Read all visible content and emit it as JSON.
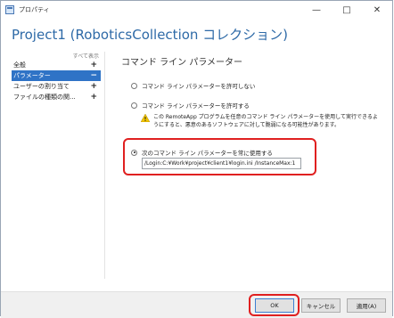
{
  "window": {
    "title": "プロパティ",
    "minimize": "—",
    "maximize": "□",
    "close": "✕"
  },
  "heading": "Project1 (RoboticsCollection コレクション)",
  "sidebar": {
    "show_all": "すべて表示",
    "items": [
      {
        "label": "全般",
        "sign": "+"
      },
      {
        "label": "パラメーター",
        "sign": "−"
      },
      {
        "label": "ユーザーの割り当て",
        "sign": "+"
      },
      {
        "label": "ファイルの種類の関...",
        "sign": "+"
      }
    ]
  },
  "main": {
    "section_title": "コマンド ライン パラメーター",
    "options": [
      {
        "label": "コマンド ライン パラメーターを許可しない",
        "checked": false
      },
      {
        "label": "コマンド ライン パラメーターを許可する",
        "checked": false
      },
      {
        "label": "次のコマンド ライン パラメーターを常に使用する",
        "checked": true
      }
    ],
    "warning": "この RemoteApp プログラムを任意のコマンド ライン パラメーターを使用して実行できるようにすると、悪意のあるソフトウェアに対して脆弱になる可能性があります。",
    "command_value": "/Login:C:¥Work¥project¥client1¥login.ini /InstanceMax:1"
  },
  "footer": {
    "ok": "OK",
    "cancel": "キャンセル",
    "apply": "適用(A)"
  },
  "colors": {
    "accent": "#2f73c6",
    "heading": "#2e6aa7",
    "highlight": "#e02020",
    "warning": "#f2c500"
  }
}
